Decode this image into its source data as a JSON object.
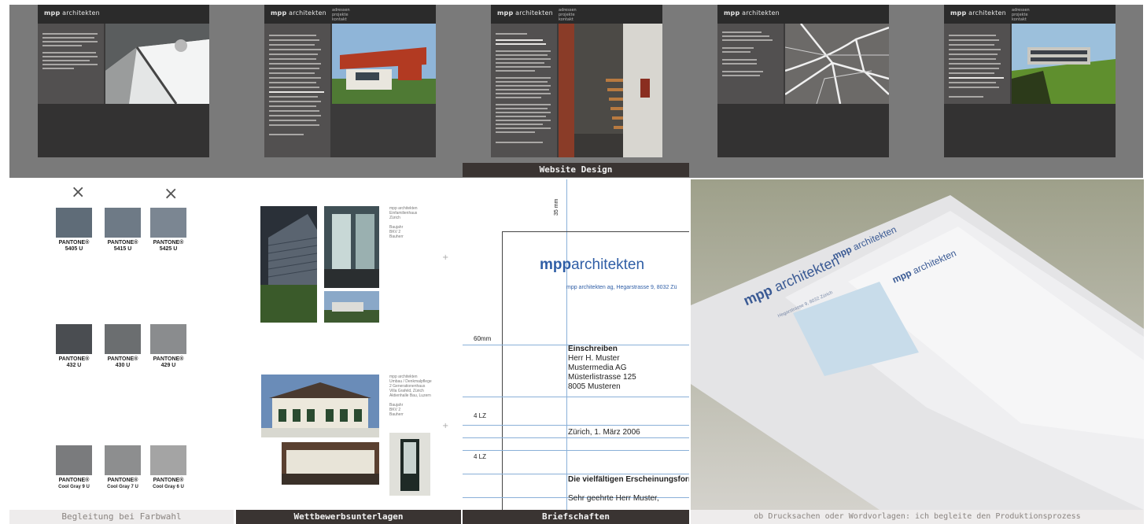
{
  "website": {
    "logo_bold": "mpp",
    "logo_rest": "architekten",
    "nav_lines": [
      "adressen",
      "projekte",
      "kontakt"
    ],
    "caption": "Website Design"
  },
  "colors": {
    "caption": "Begleitung bei Farbwahl",
    "rows": [
      [
        {
          "label": "PANTONE®",
          "code": "5405 U",
          "color": "#5f6c78"
        },
        {
          "label": "PANTONE®",
          "code": "5415 U",
          "color": "#6e7a86"
        },
        {
          "label": "PANTONE®",
          "code": "5425 U",
          "color": "#7b8692"
        }
      ],
      [
        {
          "label": "PANTONE®",
          "code": "432 U",
          "color": "#4a4d51"
        },
        {
          "label": "PANTONE®",
          "code": "430 U",
          "color": "#6b6e70"
        },
        {
          "label": "PANTONE®",
          "code": "429 U",
          "color": "#8a8c8e"
        }
      ],
      [
        {
          "label": "PANTONE®",
          "code": "Cool Gray 9 U",
          "color": "#7a7b7d"
        },
        {
          "label": "PANTONE®",
          "code": "Cool Gray 7 U",
          "color": "#8d8e8f"
        },
        {
          "label": "PANTONE®",
          "code": "Cool Gray 6 U",
          "color": "#a4a4a4"
        }
      ]
    ],
    "x_marks": [
      "×",
      "×"
    ]
  },
  "competition": {
    "caption": "Wettbewerbsunterlagen",
    "block1": [
      "mpp architekten",
      "Einfamilienhaus",
      "Zürich",
      "",
      "Baujahr",
      "BKV 2",
      "Bauherr"
    ],
    "block2": [
      "mpp architekten",
      "Umbau / Denkmalpflege",
      "2 Generationenhaus",
      "Villa Grafeld, Zürich",
      "Aktienhalle Bau, Luzern",
      "",
      "Baujahr",
      "BKV 2",
      "Bauherr"
    ],
    "plus": "+"
  },
  "letterhead": {
    "caption": "Briefschaften",
    "logo_bold": "mpp",
    "logo_rest": "architekten",
    "address_line": "mpp architekten ag, Hegarstrasse 9, 8032 Zü",
    "dim_35": "35 mm",
    "dim_60": "60mm",
    "lz1": "4 LZ",
    "lz2": "4 LZ",
    "recipient": [
      "Einschreiben",
      "Herr H. Muster",
      "Mustermedia AG",
      "Müsterlistrasse 125",
      "8005 Musteren"
    ],
    "date": "Zürich, 1. März 2006",
    "subject": "Die vielfältigen Erscheinungsforme",
    "salutation": "Sehr geehrte Herr Muster,"
  },
  "print": {
    "caption": "ob Drucksachen oder Wordvorlagen: ich begleite den Produktionsprozess",
    "env_logo_bold": "mpp",
    "env_logo_rest": "architekten",
    "env_address": "Hegarstrasse 9, 8032 Zürich"
  },
  "palette": {
    "accent_blue": "#2f5ea6",
    "dark_gray": "#3a3432"
  }
}
